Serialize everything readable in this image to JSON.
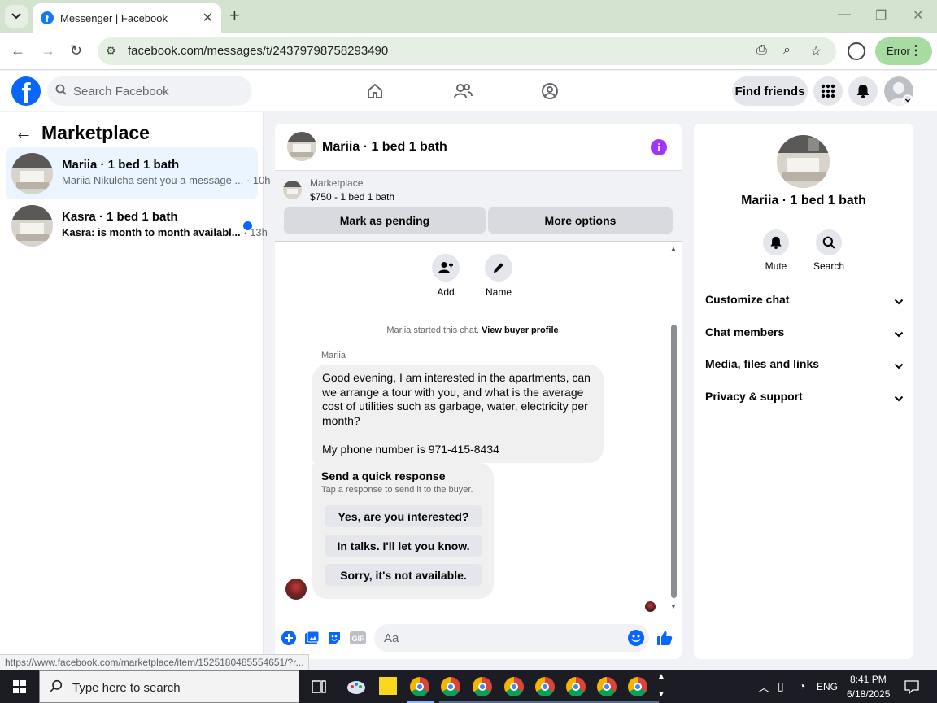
{
  "browser": {
    "tab_title": "Messenger | Facebook",
    "url": "facebook.com/messages/t/24379798758293490",
    "profile_button": "Error"
  },
  "fb": {
    "search_placeholder": "Search Facebook",
    "find_friends": "Find friends"
  },
  "marketplace": {
    "title": "Marketplace",
    "conversations": [
      {
        "name": "Mariia · 1 bed 1 bath",
        "snippet": "Mariia Nikulcha sent you a message ...",
        "time": "· 10h",
        "unread": false
      },
      {
        "name": "Kasra · 1 bed 1 bath",
        "snippet": "Kasra: is month to month availabl...",
        "time": "· 13h",
        "unread": true
      }
    ]
  },
  "chat": {
    "title": "Mariia · 1 bed 1 bath",
    "listing_source": "Marketplace",
    "listing_price": "$750 - 1 bed 1 bath",
    "mark_pending": "Mark as pending",
    "more_options": "More options",
    "actions": {
      "add": "Add",
      "name": "Name"
    },
    "started_text": "Mariia started this chat.",
    "view_buyer_profile": "View buyer profile",
    "sender": "Mariia",
    "message_line1": "Good evening, I am interested in the apartments, can we arrange a tour with you, and what is the average cost of utilities such as garbage, water, electricity per month?",
    "message_line2": "My phone number is 971-415-8434",
    "quick_title": "Send a quick response",
    "quick_sub": "Tap a response to send it to the buyer.",
    "quick_responses": [
      "Yes, are you interested?",
      "In talks. I'll let you know.",
      "Sorry, it's not available."
    ],
    "input_placeholder": "Aa"
  },
  "info_panel": {
    "title": "Mariia · 1 bed 1 bath",
    "mute": "Mute",
    "search": "Search",
    "sections": [
      "Customize chat",
      "Chat members",
      "Media, files and links",
      "Privacy & support"
    ]
  },
  "status_url": "https://www.facebook.com/marketplace/item/1525180485554651/?r...",
  "taskbar": {
    "search_placeholder": "Type here to search",
    "lang": "ENG",
    "time": "8:41 PM",
    "date": "6/18/2025"
  },
  "colors": {
    "fb_blue": "#0866ff",
    "info_purple": "#a033ff",
    "active_conv": "#ebf5ff"
  }
}
